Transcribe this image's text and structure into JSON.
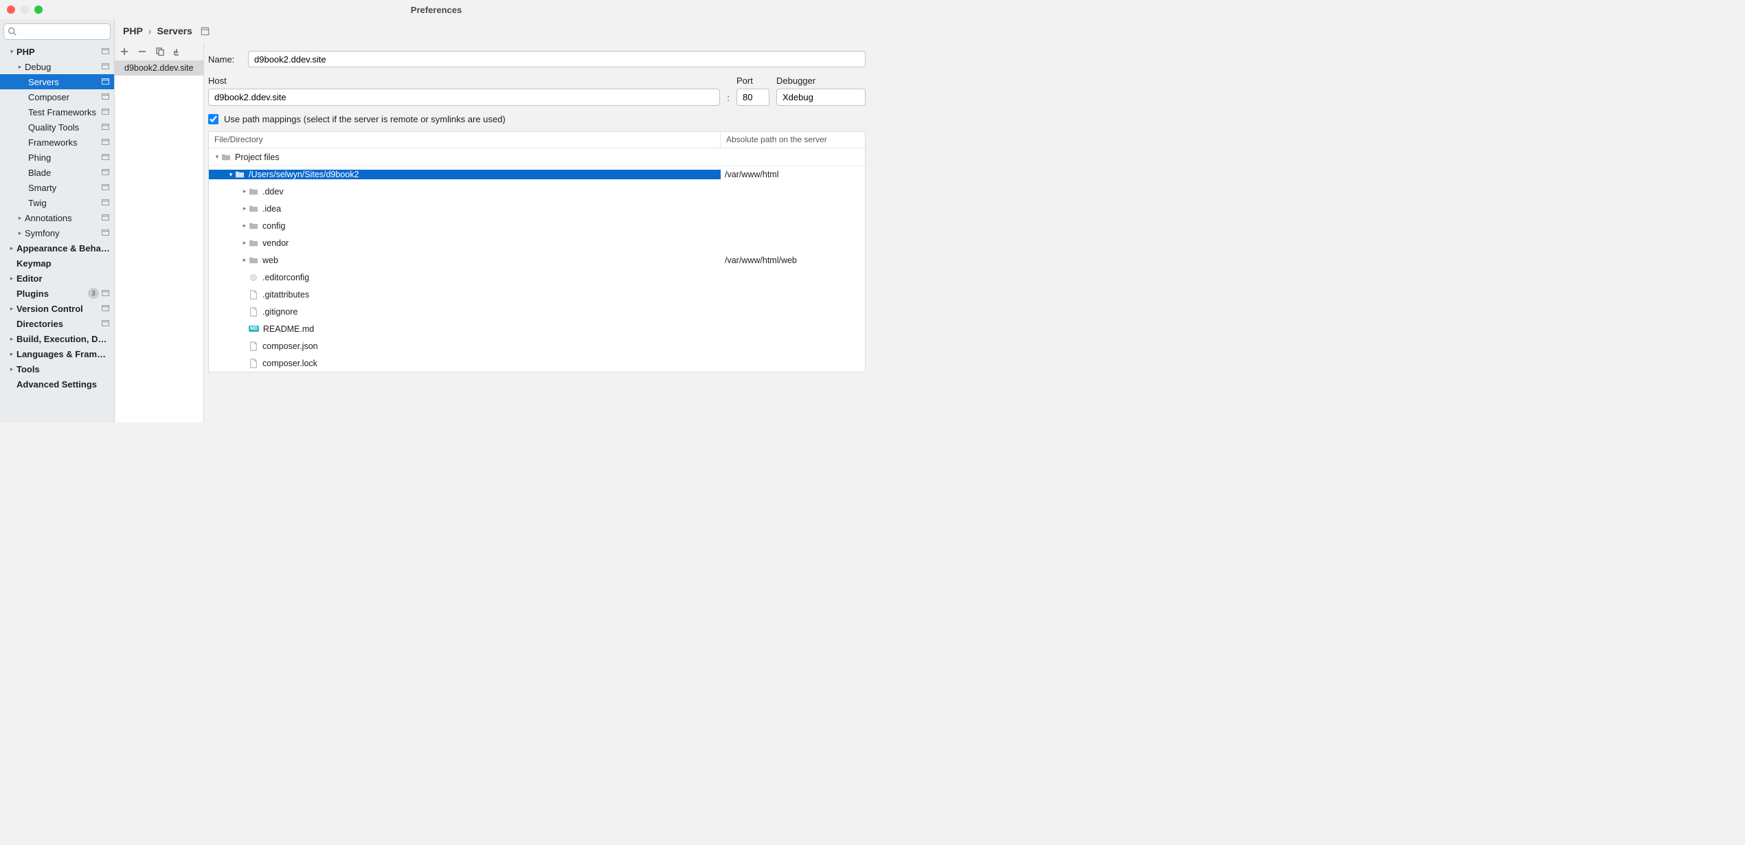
{
  "window": {
    "title": "Preferences"
  },
  "search": {
    "placeholder": ""
  },
  "sidebar": {
    "items": [
      {
        "label": "PHP",
        "bold": true,
        "chevron": "down",
        "indent": 0,
        "suffix": true
      },
      {
        "label": "Debug",
        "chevron": "right",
        "indent": 1,
        "suffix": true
      },
      {
        "label": "Servers",
        "indent": 2,
        "selected": true,
        "suffix": true
      },
      {
        "label": "Composer",
        "indent": 2,
        "suffix": true
      },
      {
        "label": "Test Frameworks",
        "indent": 2,
        "suffix": true
      },
      {
        "label": "Quality Tools",
        "indent": 2,
        "suffix": true
      },
      {
        "label": "Frameworks",
        "indent": 2,
        "suffix": true
      },
      {
        "label": "Phing",
        "indent": 2,
        "suffix": true
      },
      {
        "label": "Blade",
        "indent": 2,
        "suffix": true
      },
      {
        "label": "Smarty",
        "indent": 2,
        "suffix": true
      },
      {
        "label": "Twig",
        "indent": 2,
        "suffix": true
      },
      {
        "label": "Annotations",
        "chevron": "right",
        "indent": 1,
        "suffix": true
      },
      {
        "label": "Symfony",
        "chevron": "right",
        "indent": 1,
        "suffix": true
      },
      {
        "label": "Appearance & Behavior",
        "bold": true,
        "chevron": "right",
        "indent": 0
      },
      {
        "label": "Keymap",
        "bold": true,
        "indent": 0
      },
      {
        "label": "Editor",
        "bold": true,
        "chevron": "right",
        "indent": 0
      },
      {
        "label": "Plugins",
        "bold": true,
        "indent": 0,
        "badge": "3",
        "suffix": true
      },
      {
        "label": "Version Control",
        "bold": true,
        "chevron": "right",
        "indent": 0,
        "suffix": true
      },
      {
        "label": "Directories",
        "bold": true,
        "indent": 0,
        "suffix": true
      },
      {
        "label": "Build, Execution, Deployment",
        "bold": true,
        "chevron": "right",
        "indent": 0
      },
      {
        "label": "Languages & Frameworks",
        "bold": true,
        "chevron": "right",
        "indent": 0
      },
      {
        "label": "Tools",
        "bold": true,
        "chevron": "right",
        "indent": 0
      },
      {
        "label": "Advanced Settings",
        "bold": true,
        "indent": 0
      }
    ]
  },
  "breadcrumb": {
    "root": "PHP",
    "current": "Servers"
  },
  "server_list": {
    "items": [
      {
        "name": "d9book2.ddev.site"
      }
    ]
  },
  "form": {
    "name_label": "Name:",
    "name_value": "d9book2.ddev.site",
    "host_label": "Host",
    "host_value": "d9book2.ddev.site",
    "port_label": "Port",
    "port_value": "80",
    "debugger_label": "Debugger",
    "debugger_value": "Xdebug",
    "use_mappings_label": "Use path mappings (select if the server is remote or symlinks are used)",
    "use_mappings_checked": true
  },
  "mapping": {
    "col_left": "File/Directory",
    "col_right": "Absolute path on the server",
    "rows": [
      {
        "depth": 0,
        "chevron": "down",
        "icon": "folder",
        "label": "Project files",
        "right": ""
      },
      {
        "depth": 1,
        "chevron": "down",
        "icon": "folder",
        "label": "/Users/selwyn/Sites/d9book2",
        "right": "/var/www/html",
        "selected": true
      },
      {
        "depth": 2,
        "chevron": "right",
        "icon": "folder",
        "label": ".ddev",
        "right": ""
      },
      {
        "depth": 2,
        "chevron": "right",
        "icon": "folder",
        "label": ".idea",
        "right": ""
      },
      {
        "depth": 2,
        "chevron": "right",
        "icon": "folder",
        "label": "config",
        "right": ""
      },
      {
        "depth": 2,
        "chevron": "right",
        "icon": "folder",
        "label": "vendor",
        "right": ""
      },
      {
        "depth": 2,
        "chevron": "right",
        "icon": "folder",
        "label": "web",
        "right": "/var/www/html/web"
      },
      {
        "depth": 2,
        "icon": "gear",
        "label": ".editorconfig",
        "right": ""
      },
      {
        "depth": 2,
        "icon": "file",
        "label": ".gitattributes",
        "right": ""
      },
      {
        "depth": 2,
        "icon": "file",
        "label": ".gitignore",
        "right": ""
      },
      {
        "depth": 2,
        "icon": "md",
        "label": "README.md",
        "right": ""
      },
      {
        "depth": 2,
        "icon": "file",
        "label": "composer.json",
        "right": ""
      },
      {
        "depth": 2,
        "icon": "file",
        "label": "composer.lock",
        "right": ""
      }
    ]
  }
}
